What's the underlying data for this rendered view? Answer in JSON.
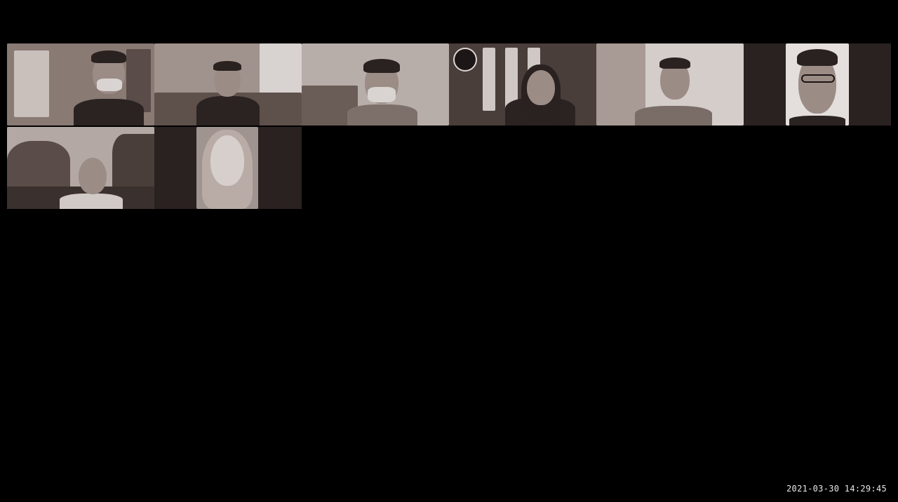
{
  "meeting": {
    "timestamp": "2021-03-30 14:29:45"
  },
  "colors": {
    "background": "#000000",
    "tile_tone": "#8e7f7a"
  }
}
